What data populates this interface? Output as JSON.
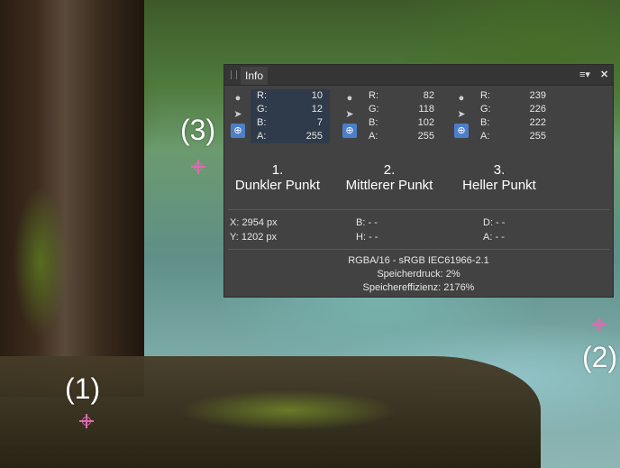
{
  "markers": {
    "m1": "(1)",
    "m2": "(2)",
    "m3": "(3)"
  },
  "panel": {
    "tab_label": "Info",
    "menu_icon": "hamburger-menu-icon",
    "close_icon": "close-icon",
    "samples": [
      {
        "R": "10",
        "G": "12",
        "B": "7",
        "A": "255",
        "caption_num": "1.",
        "caption": "Dunkler Punkt"
      },
      {
        "R": "82",
        "G": "118",
        "B": "102",
        "A": "255",
        "caption_num": "2.",
        "caption": "Mittlerer Punkt"
      },
      {
        "R": "239",
        "G": "226",
        "B": "222",
        "A": "255",
        "caption_num": "3.",
        "caption": "Heller Punkt"
      }
    ],
    "labels": {
      "R": "R:",
      "G": "G:",
      "B": "B:",
      "A": "A:"
    },
    "coords": {
      "x_label": "X:",
      "x_value": "2954 px",
      "y_label": "Y:",
      "y_value": "1202 px"
    },
    "extra": {
      "b_label": "B:",
      "b_value": "- -",
      "h_label": "H:",
      "h_value": "- -",
      "d_label": "D:",
      "d_value": "- -",
      "a_label": "A:",
      "a_value": "- -"
    },
    "footer": {
      "format": "RGBA/16 - sRGB IEC61966-2.1",
      "memory_pressure": "Speicherdruck: 2%",
      "memory_efficiency": "Speichereffizienz: 2176%"
    }
  },
  "colors": {
    "marker": "#e06ab0",
    "selection": "#2f3b4a",
    "accent": "#4d7fc9",
    "panel_bg": "#424242"
  }
}
